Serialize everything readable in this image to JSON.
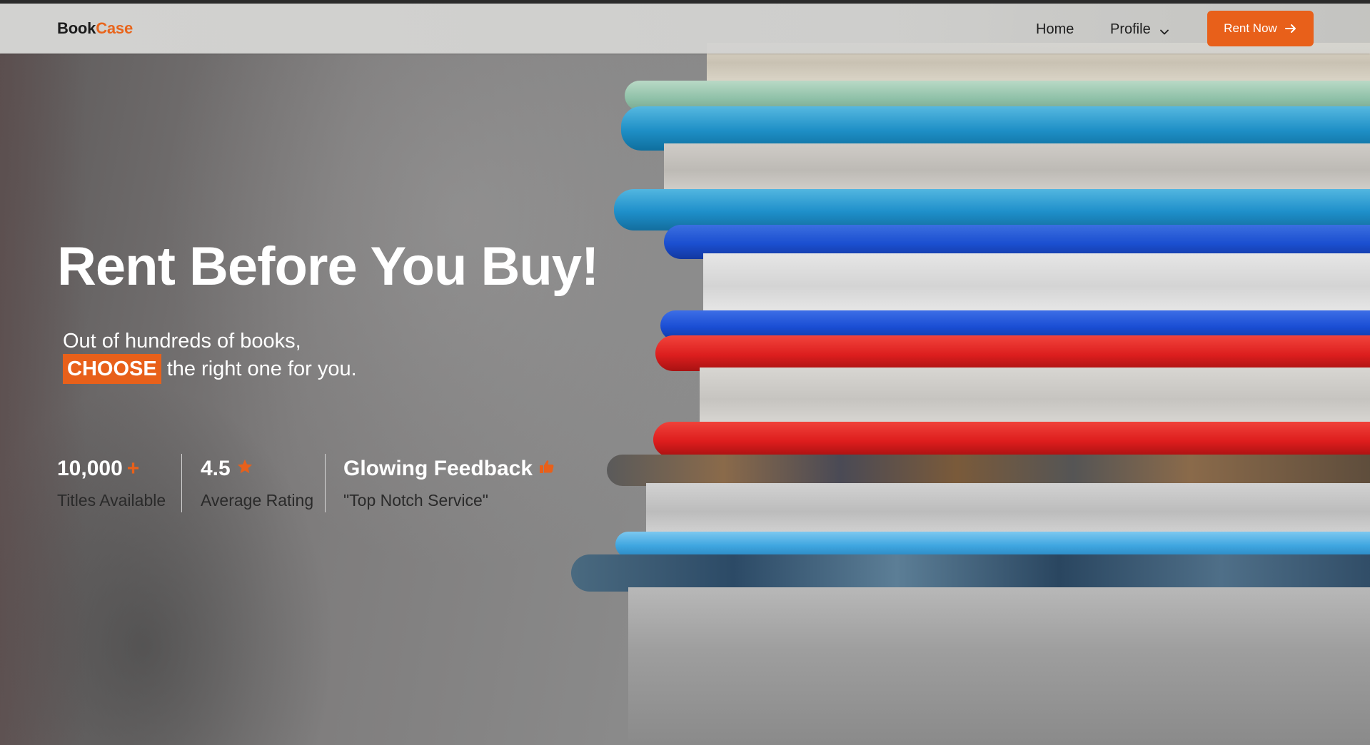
{
  "brand": {
    "part1": "Book",
    "part2": "Case"
  },
  "nav": {
    "home": "Home",
    "profile": "Profile",
    "rent_now": "Rent Now"
  },
  "hero": {
    "headline": "Rent Before You Buy!",
    "sub_line1": "Out of hundreds of books,",
    "highlight": "CHOOSE",
    "sub_line2_rest": "the right one for you."
  },
  "stats": [
    {
      "value": "10,000",
      "suffix": "+",
      "label": "Titles Available"
    },
    {
      "value": "4.5",
      "icon": "star-icon",
      "label": "Average Rating"
    },
    {
      "value": "Glowing Feedback",
      "icon": "thumbs-up-icon",
      "label": "\"Top Notch Service\""
    }
  ],
  "colors": {
    "accent": "#e8601a",
    "text_light": "#ffffff",
    "text_dark": "#1e1e1e"
  }
}
